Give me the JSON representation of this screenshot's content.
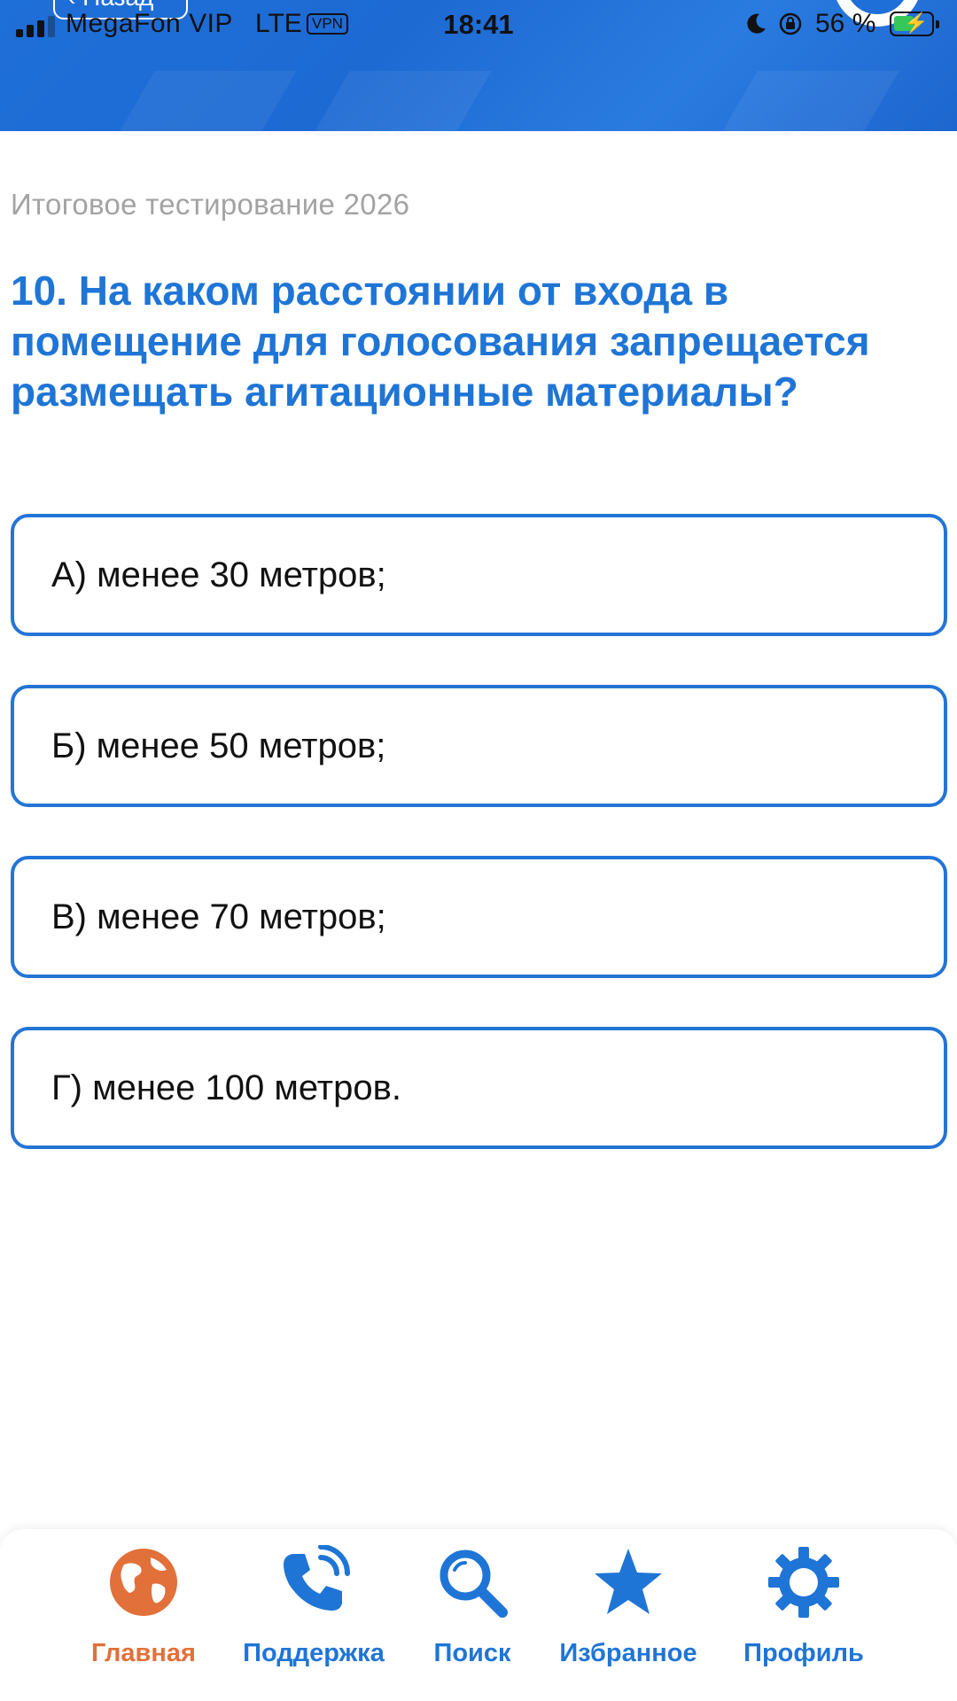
{
  "status_bar": {
    "carrier": "MegaFon VIP",
    "network": "LTE",
    "vpn": "VPN",
    "time": "18:41",
    "battery": "56 %"
  },
  "header": {
    "back_label": "‹ Назад",
    "brand_color": "#1f6fd8"
  },
  "quiz": {
    "subtitle": "Итоговое тестирование 2026",
    "question": "10. На каком расстоянии от входа в помещение для голосования запрещается размещать агитационные материалы?",
    "answers": [
      "А) менее 30 метров;",
      "Б) менее 50 метров;",
      "В) менее 70 метров;",
      "Г) менее 100 метров."
    ]
  },
  "tabbar": {
    "accent_active": "#e2703a",
    "accent": "#1f75d6",
    "items": [
      {
        "label": "Главная",
        "icon": "globe-icon"
      },
      {
        "label": "Поддержка",
        "icon": "phone-icon"
      },
      {
        "label": "Поиск",
        "icon": "search-icon"
      },
      {
        "label": "Избранное",
        "icon": "star-icon"
      },
      {
        "label": "Профиль",
        "icon": "gear-icon"
      }
    ]
  }
}
